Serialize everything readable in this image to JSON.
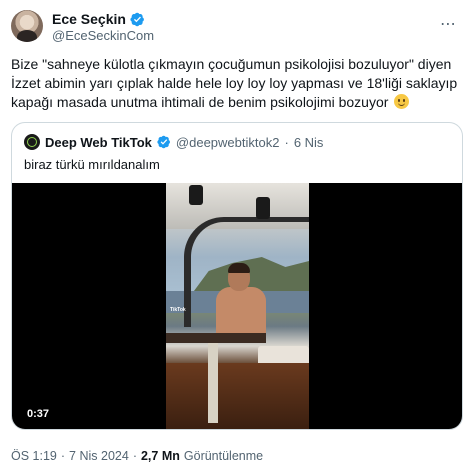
{
  "author": {
    "display_name": "Ece Seçkin",
    "handle": "@EceSeckinCom",
    "verified_color": "#1d9bf0"
  },
  "tweet": {
    "text": "Bize \"sahneye külotla çıkmayın çocuğumun psikolojisi bozuluyor\" diyen İzzet abimin yarı çıplak halde hele loy loy loy yapması ve 18'liği saklayıp kapağı masada unutma ihtimali de benim psikolojimi bozuyor",
    "emoji": "slightly-smiling-face"
  },
  "quote": {
    "display_name": "Deep Web TikTok",
    "handle": "@deepwebtiktok2",
    "separator": "·",
    "date": "6 Nis",
    "text": "biraz türkü mırıldanalım",
    "video": {
      "duration": "0:37",
      "overlay_text": "TikTok"
    }
  },
  "meta": {
    "time": "ÖS 1:19",
    "separator": "·",
    "date": "7 Nis 2024",
    "views_count": "2,7 Mn",
    "views_label": "Görüntülenme"
  },
  "icons": {
    "more": "more-options-icon",
    "verified": "verified-badge-icon"
  }
}
